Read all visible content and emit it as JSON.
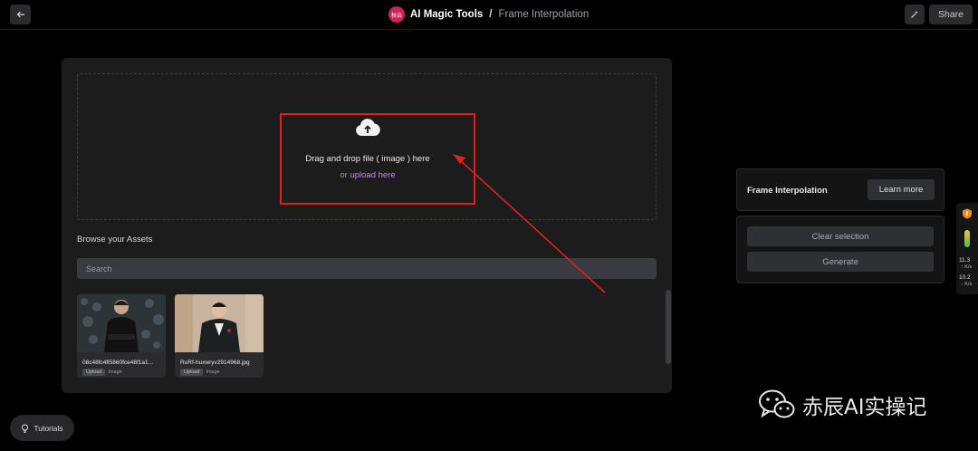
{
  "header": {
    "avatar_text": "秋云",
    "app_name": "AI Magic Tools",
    "separator": "/",
    "page_name": "Frame Interpolation",
    "share_label": "Share"
  },
  "dropzone": {
    "text": "Drag and drop file ( image ) here",
    "sub_prefix": "or ",
    "sub_link": "upload here"
  },
  "assets": {
    "title": "Browse your Assets",
    "search_placeholder": "Search",
    "items": [
      {
        "name": "08c48fc4fl5860fce48f1a1...",
        "badge": "Upload",
        "type": "Image"
      },
      {
        "name": "RuRf-huxwryv2914968.jpg",
        "badge": "Upload",
        "type": "Image"
      }
    ]
  },
  "info_panel": {
    "title": "Frame Interpolation",
    "learn_more": "Learn more"
  },
  "actions": {
    "clear": "Clear selection",
    "generate": "Generate"
  },
  "speed_widget": {
    "up_value": "11.3",
    "up_unit": "↑ K/s",
    "down_value": "10.2",
    "down_unit": "↓ K/s"
  },
  "tutorials": {
    "label": "Tutorials"
  },
  "watermark": {
    "text": "赤辰AI实操记"
  },
  "colors": {
    "accent_link": "#b98cf6",
    "highlight_red": "#e02020",
    "avatar_bg": "#c8235b"
  }
}
